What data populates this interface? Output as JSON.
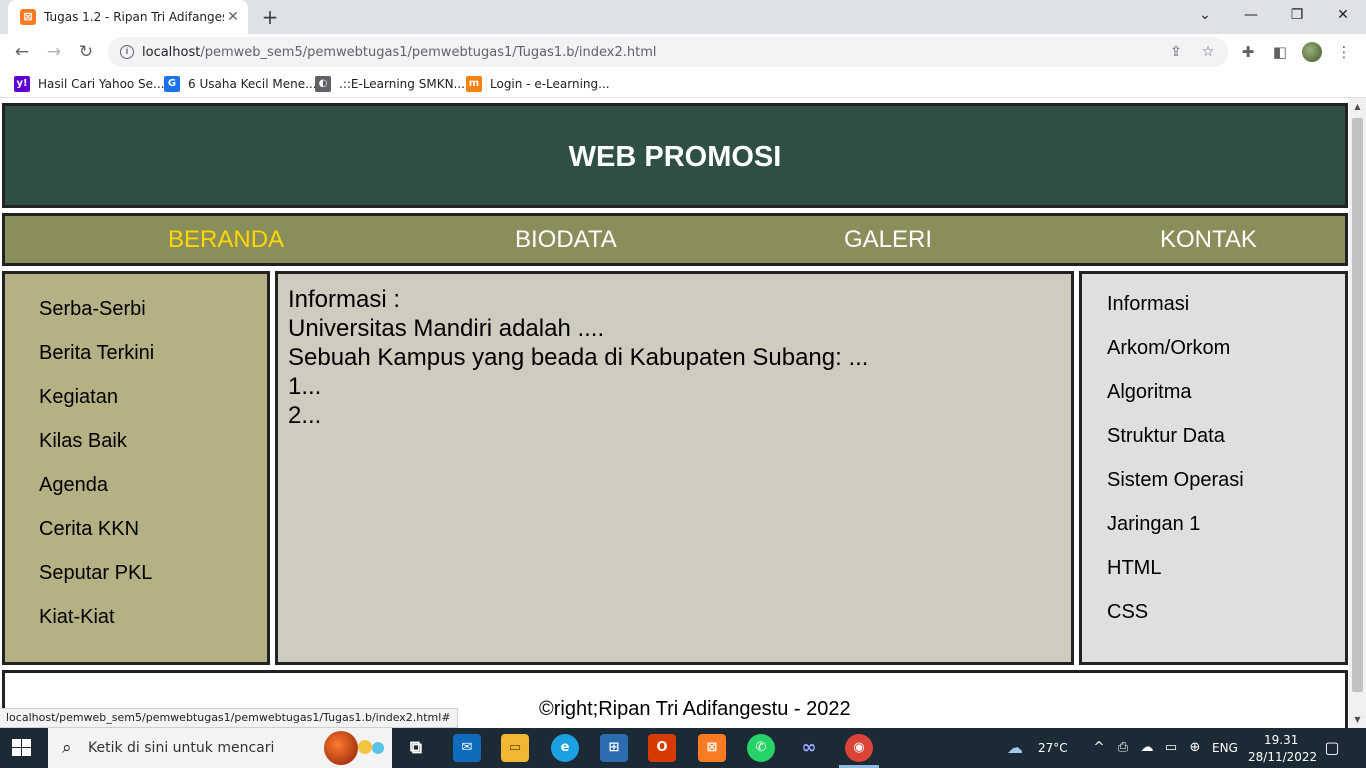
{
  "browser": {
    "tab_title": "Tugas 1.2 - Ripan Tri Adifangestu",
    "tab_favicon": "xampp-icon",
    "new_tab": "+",
    "url_host": "localhost",
    "url_path": "/pemweb_sem5/pemwebtugas1/pemwebtugas1/Tugas1.b/index2.html",
    "bookmarks": [
      {
        "label": "Hasil Cari Yahoo Se...",
        "icon": "yahoo-icon",
        "color": "#6001d2",
        "glyph": "y!"
      },
      {
        "label": "6 Usaha Kecil Mene...",
        "icon": "site-icon",
        "color": "#1a73e8",
        "glyph": "G"
      },
      {
        "label": ".::E-Learning SMKN...",
        "icon": "globe-icon",
        "color": "#5f6368",
        "glyph": "◐"
      },
      {
        "label": "Login - e-Learning...",
        "icon": "moodle-icon",
        "color": "#f98012",
        "glyph": "m"
      }
    ],
    "status_url": "localhost/pemweb_sem5/pemwebtugas1/pemwebtugas1/Tugas1.b/index2.html#"
  },
  "page": {
    "header_title": "WEB PROMOSI",
    "nav": [
      {
        "label": "BERANDA",
        "active": true
      },
      {
        "label": "BIODATA",
        "active": false
      },
      {
        "label": "GALERI",
        "active": false
      },
      {
        "label": "KONTAK",
        "active": false
      }
    ],
    "left_menu": [
      "Serba-Serbi",
      "Berita Terkini",
      "Kegiatan",
      "Kilas Baik",
      "Agenda",
      "Cerita KKN",
      "Seputar PKL",
      "Kiat-Kiat"
    ],
    "main_lines": [
      "Informasi :",
      "Universitas Mandiri adalah ....",
      "Sebuah Kampus yang beada di Kabupaten Subang: ...",
      "1...",
      "2..."
    ],
    "right_menu": [
      "Informasi",
      "Arkom/Orkom",
      "Algoritma",
      "Struktur Data",
      "Sistem Operasi",
      "Jaringan 1",
      "HTML",
      "CSS"
    ],
    "footer": "©right;Ripan Tri Adifangestu - 2022"
  },
  "colors": {
    "header_bg": "#2f4f43",
    "nav_bg": "#8a8e5a",
    "nav_active": "#ffd700",
    "left_bg": "#b5b184",
    "main_bg": "#cfccbf",
    "right_bg": "#dfdfdd"
  },
  "taskbar": {
    "search_placeholder": "Ketik di sini untuk mencari",
    "weather": "27°C",
    "language": "ENG",
    "time": "19.31",
    "date": "28/11/2022"
  }
}
